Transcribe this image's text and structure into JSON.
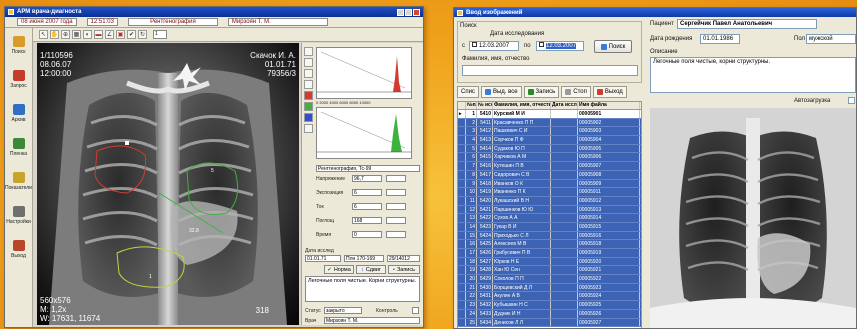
{
  "left_window": {
    "title": "АРМ врача-диагноста",
    "menu": {
      "date": "08 июня 2007 года",
      "time": "12:51:03",
      "department": "Рентгенография",
      "doctor": "Мирзоян Т. М."
    },
    "sidebar": [
      {
        "label": "Поиск",
        "icon": "search-icon",
        "color": "#d89a2a"
      },
      {
        "label": "Запрос",
        "icon": "request-icon",
        "color": "#c43c2c"
      },
      {
        "label": "Архив",
        "icon": "archive-icon",
        "color": "#2f6fc4"
      },
      {
        "label": "Пленка",
        "icon": "film-icon",
        "color": "#3a8a3a"
      },
      {
        "label": "Показатели",
        "icon": "stats-icon",
        "color": "#c9a22c"
      },
      {
        "label": "Настройки",
        "icon": "settings-icon",
        "color": "#6f6f6f"
      },
      {
        "label": "Выход",
        "icon": "exit-icon",
        "color": "#b8462a"
      }
    ],
    "toolbar": {
      "frame_input": "1"
    },
    "image_overlay": {
      "top_left_1": "1/110596",
      "top_left_2": "08.06.07",
      "top_left_3": "12:00:00",
      "top_right_1": "Скачок И. А.",
      "top_right_2": "01.01.71",
      "top_right_3": "79356/3",
      "bottom_left_1": "560x576",
      "bottom_left_2": "M: 1,2x",
      "bottom_left_3": "W: 17631, 11674",
      "bottom_right": "318",
      "measure_1": "32.8",
      "measure_2": "5",
      "measure_3": "1"
    },
    "control_panel": {
      "hist_axis": "0  2000  4000  6000  8000  10000",
      "dose_label": "Рентгенография, Тс-99",
      "fields": [
        {
          "label": "Напряжение",
          "value": "96,7"
        },
        {
          "label": "Экспозиция",
          "value": "6"
        },
        {
          "label": "Ток",
          "value": "6"
        },
        {
          "label": "Поглощ",
          "value": "168"
        },
        {
          "label": "Время",
          "value": "0"
        }
      ],
      "study_date_label": "Дата исслед",
      "study_date": "01.01.71",
      "film_label": "Плн 170-169",
      "film_code": "29/14012",
      "buttons": {
        "normal": "Норма",
        "replace": "Сдвиг",
        "save": "Запись"
      },
      "notes": "Легочные поля чистые. Корни структурны.",
      "status_label": "Статус",
      "status_value": "закрыто",
      "control_label": "Контроль",
      "doctor_label": "Врач",
      "doctor_value": "Мирзоян Т. М."
    }
  },
  "right_window": {
    "title": "Ввод изображений",
    "search": {
      "group_label": "Поиск",
      "date_label": "Дата исследования",
      "from_label": "с",
      "date_from": "12.03.2007",
      "to_label": "по",
      "date_to": "12.03.2007",
      "button": "Поиск",
      "fio_label": "Фамилия, имя, отчество"
    },
    "tabs": [
      {
        "label": "Спис",
        "icon": "list-icon"
      },
      {
        "label": "Выд. все",
        "icon": "select-all-icon"
      },
      {
        "label": "Запись",
        "icon": "record-icon"
      },
      {
        "label": "Стоп",
        "icon": "stop-icon"
      },
      {
        "label": "Выход",
        "icon": "exit-icon"
      }
    ],
    "grid_headers": [
      "",
      "№п/п",
      "№ исслед",
      "Фамилия, имя, отчество",
      "Дата исслед",
      "Имя файла"
    ],
    "rows": [
      {
        "n": "1",
        "id": "5410",
        "name": "Курский М И",
        "file": "00005901"
      },
      {
        "n": "2",
        "id": "5411",
        "name": "Красавченко П П",
        "file": "00005902"
      },
      {
        "n": "3",
        "id": "5412",
        "name": "Пашкевич С И",
        "file": "00005903"
      },
      {
        "n": "4",
        "id": "5413",
        "name": "Сорчков П Ф",
        "file": "00005904"
      },
      {
        "n": "5",
        "id": "5414",
        "name": "Судаков Ю П",
        "file": "00005905"
      },
      {
        "n": "6",
        "id": "5415",
        "name": "Харчиков А М",
        "file": "00005906"
      },
      {
        "n": "7",
        "id": "5416",
        "name": "Кутешин П В",
        "file": "00005907"
      },
      {
        "n": "8",
        "id": "5417",
        "name": "Сидорович С В",
        "file": "00005908"
      },
      {
        "n": "9",
        "id": "5418",
        "name": "Иванков О К",
        "file": "00005909"
      },
      {
        "n": "10",
        "id": "5419",
        "name": "Иваненко П К",
        "file": "00005911"
      },
      {
        "n": "11",
        "id": "5420",
        "name": "Лукашский В Н",
        "file": "00005912"
      },
      {
        "n": "12",
        "id": "5421",
        "name": "Паршинков Ю Ю",
        "file": "00005913"
      },
      {
        "n": "13",
        "id": "5422",
        "name": "Сухов А А",
        "file": "00005914"
      },
      {
        "n": "14",
        "id": "5423",
        "name": "Гукар В И",
        "file": "00005915"
      },
      {
        "n": "15",
        "id": "5424",
        "name": "Приходько С Л",
        "file": "00005916"
      },
      {
        "n": "16",
        "id": "5425",
        "name": "Алексеев М В",
        "file": "00005918"
      },
      {
        "n": "17",
        "id": "5426",
        "name": "Грибусевич П В",
        "file": "00005919"
      },
      {
        "n": "18",
        "id": "5427",
        "name": "Юрков Н Е",
        "file": "00005920"
      },
      {
        "n": "19",
        "id": "5428",
        "name": "Хан Ю Сен",
        "file": "00005921"
      },
      {
        "n": "20",
        "id": "5429",
        "name": "Соколов П П",
        "file": "00005922"
      },
      {
        "n": "21",
        "id": "5430",
        "name": "Борщевский Д Л",
        "file": "00005923"
      },
      {
        "n": "22",
        "id": "5431",
        "name": "Акулин А В",
        "file": "00005924"
      },
      {
        "n": "23",
        "id": "5432",
        "name": "Кубышкин Н С",
        "file": "00005925"
      },
      {
        "n": "24",
        "id": "5433",
        "name": "Дудник И Н",
        "file": "00005926"
      },
      {
        "n": "25",
        "id": "5434",
        "name": "Денисов Л Л",
        "file": "00005927"
      }
    ],
    "patient": {
      "patient_label": "Пациент",
      "patient_name": "Сергейчик Павел Анатольевич",
      "dob_label": "Дата рождения",
      "dob": "01.01.1986",
      "sex_label": "Пол",
      "sex": "мужской",
      "desc_label": "Описание",
      "desc": "Легочные поля чистые, корни структурны.",
      "autoload": "Автозагрузка"
    }
  }
}
